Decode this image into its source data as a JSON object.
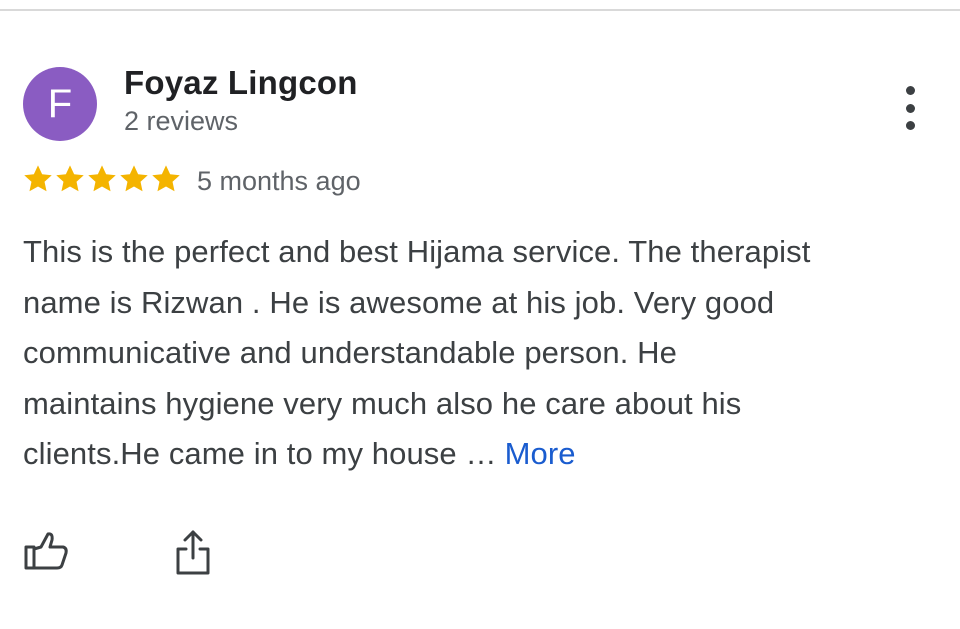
{
  "reviewer": {
    "avatar_letter": "F",
    "avatar_color": "#8a5cc2",
    "name": "Foyaz Lingcon",
    "review_count": "2 reviews"
  },
  "rating": {
    "stars": 5,
    "max_stars": 5,
    "star_color": "#f4b400",
    "time_ago": "5 months ago"
  },
  "review": {
    "lines": [
      "This is the perfect and best Hijama service. The therapist",
      "name is Rizwan . He is awesome at his job. Very good",
      "communicative and understandable person. He",
      "maintains hygiene very much also he care about his",
      "clients.He came in to my house …"
    ],
    "more_label": "More",
    "link_color": "#1a5ccf"
  },
  "icons": {
    "menu": "more-vert-icon",
    "like": "thumbs-up-icon",
    "share": "share-icon"
  }
}
